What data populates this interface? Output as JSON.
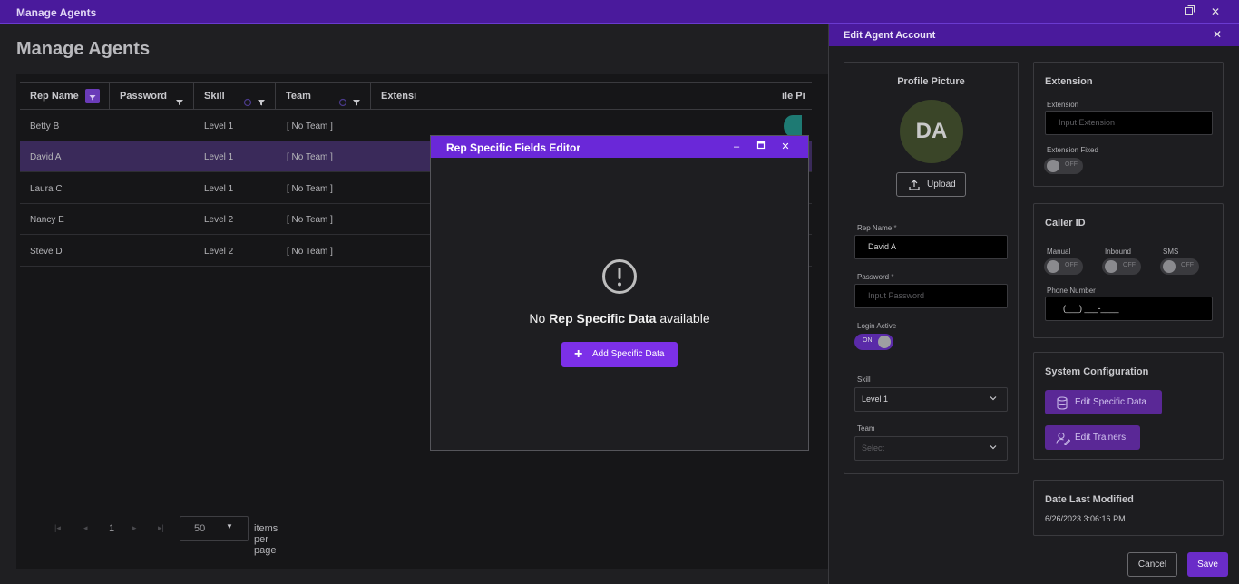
{
  "window": {
    "title": "Manage Agents"
  },
  "page": {
    "title": "Manage Agents"
  },
  "grid": {
    "columns": [
      {
        "label": "Rep Name"
      },
      {
        "label": "Password"
      },
      {
        "label": "Skill"
      },
      {
        "label": "Team"
      },
      {
        "label": "Extensi"
      },
      {
        "label": "ile Pi"
      }
    ],
    "rows": [
      {
        "name": "Betty B",
        "skill": "Level 1",
        "team": "[ No Team ]",
        "color": "#1e7a73"
      },
      {
        "name": "David A",
        "skill": "Level 1",
        "team": "[ No Team ]",
        "color": "#a4781e"
      },
      {
        "name": "Laura C",
        "skill": "Level 1",
        "team": "[ No Team ]",
        "color": "#a46a1e"
      },
      {
        "name": "Nancy E",
        "skill": "Level 2",
        "team": "[ No Team ]",
        "color": "#4d5c32"
      },
      {
        "name": "Steve D",
        "skill": "Level 2",
        "team": "[ No Team ]",
        "color": "#8a3ac0"
      }
    ]
  },
  "pager": {
    "page": "1",
    "per_page": "50",
    "per_page_label": "items per page"
  },
  "modal": {
    "title": "Rep Specific Fields Editor",
    "empty_prefix": "No",
    "empty_bold": "Rep Specific Data",
    "empty_suffix": "available",
    "add_label": "Add Specific Data"
  },
  "panel": {
    "title": "Edit Agent Account",
    "profile": {
      "title": "Profile Picture",
      "initials": "DA",
      "upload_label": "Upload"
    },
    "rep_name": {
      "label": "Rep Name",
      "required": "*",
      "value": "David A"
    },
    "password": {
      "label": "Password",
      "required": "*",
      "placeholder": "Input Password"
    },
    "login_active": {
      "label": "Login Active",
      "state": "ON"
    },
    "skill": {
      "label": "Skill",
      "value": "Level 1"
    },
    "team": {
      "label": "Team",
      "placeholder": "Select"
    },
    "extension": {
      "title": "Extension",
      "field_label": "Extension",
      "placeholder": "Input Extension",
      "fixed_label": "Extension Fixed",
      "fixed_state": "OFF"
    },
    "caller_id": {
      "title": "Caller ID",
      "manual_label": "Manual",
      "manual_state": "OFF",
      "inbound_label": "Inbound",
      "inbound_state": "OFF",
      "sms_label": "SMS",
      "sms_state": "OFF",
      "phone_label": "Phone Number",
      "phone_value": "(___) ___-____"
    },
    "system": {
      "title": "System Configuration",
      "edit_specific_label": "Edit Specific Data",
      "edit_trainers_label": "Edit Trainers"
    },
    "modified": {
      "title": "Date Last Modified",
      "value": "6/26/2023 3:06:16 PM"
    },
    "cancel_label": "Cancel",
    "save_label": "Save"
  },
  "colors": {
    "accent": "#6a28d8",
    "header": "#4a1a9c"
  }
}
